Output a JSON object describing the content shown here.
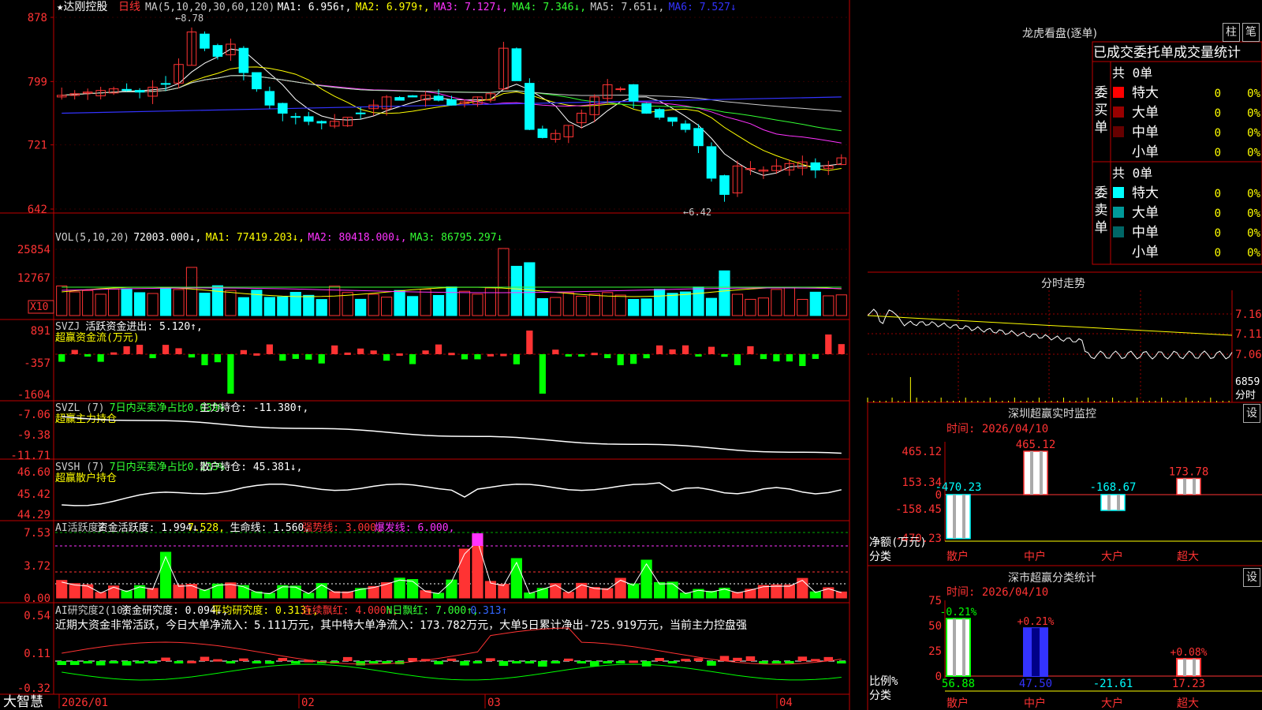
{
  "stock": {
    "title": "★达刚控股",
    "period": "日线"
  },
  "k": {
    "legend": [
      {
        "text": "MA(5,10,20,30,60,120)",
        "color": "#cccccc"
      },
      {
        "text": "MA1: 6.956↑,",
        "color": "#ffffff"
      },
      {
        "text": "MA2: 6.979↑,",
        "color": "#ffff00"
      },
      {
        "text": "MA3: 7.127↓,",
        "color": "#ff33ff"
      },
      {
        "text": "MA4: 7.346↓,",
        "color": "#33ff33"
      },
      {
        "text": "MA5: 7.651↓,",
        "color": "#cccccc"
      },
      {
        "text": "MA6: 7.527↓",
        "color": "#3333ff"
      }
    ],
    "yticks": [
      "878",
      "799",
      "721",
      "642"
    ],
    "max_label": "8.78",
    "min_label": "6.42",
    "ylim": [
      6.42,
      8.78
    ]
  },
  "vol": {
    "legend": [
      {
        "text": "VOL(5,10,20)",
        "color": "#cccccc"
      },
      {
        "text": "72003.000↓,",
        "color": "#ffffff"
      },
      {
        "text": "MA1: 77419.203↓,",
        "color": "#ffff00"
      },
      {
        "text": "MA2: 80418.000↓,",
        "color": "#ff33ff"
      },
      {
        "text": "MA3: 86795.297↓",
        "color": "#33ff33"
      }
    ],
    "yticks": [
      "25854",
      "12767"
    ],
    "unit": "X10"
  },
  "svzj": {
    "legend": [
      {
        "text": "SVZJ",
        "color": "#cccccc"
      },
      {
        "text": "活跃资金进出: 5.120↑,",
        "color": "#ffffff"
      }
    ],
    "subtitle": "超赢资金流(万元)",
    "yticks": [
      "891",
      "-357",
      "-1604"
    ]
  },
  "svzl": {
    "legend": [
      {
        "text": "SVZL (7)",
        "color": "#cccccc"
      },
      {
        "text": "7日内买卖净占比0.039%",
        "color": "#33ff33"
      },
      {
        "text": "主力持仓: -11.380↑,",
        "color": "#ffffff"
      }
    ],
    "subtitle": "超赢主力持仓",
    "yticks": [
      "-7.06",
      "-9.38",
      "-11.71"
    ]
  },
  "svsh": {
    "legend": [
      {
        "text": "SVSH (7)",
        "color": "#cccccc"
      },
      {
        "text": "7日内买卖净占比0.233%",
        "color": "#33ff33"
      },
      {
        "text": "散户持仓: 45.381↓,",
        "color": "#ffffff"
      }
    ],
    "subtitle": "超赢散户持仓",
    "yticks": [
      "46.60",
      "45.42",
      "44.29"
    ]
  },
  "ai": {
    "legend": [
      {
        "text": "AI活跃度2",
        "color": "#cccccc"
      },
      {
        "text": "资金活跃度: 1.994↓,",
        "color": "#ffffff"
      },
      {
        "text": "7.528,",
        "color": "#ffff00"
      },
      {
        "text": "生命线: 1.560,",
        "color": "#ffffff"
      },
      {
        "text": "强势线: 3.000,",
        "color": "#ff3333"
      },
      {
        "text": "爆发线: 6.000,",
        "color": "#ff33ff"
      }
    ],
    "yticks": [
      "7.53",
      "3.72",
      "0.00"
    ]
  },
  "research": {
    "legend": [
      {
        "text": "AI研究度2(10)",
        "color": "#cccccc"
      },
      {
        "text": "资金研究度: 0.094↓,",
        "color": "#ffffff"
      },
      {
        "text": "平均研究度: 0.313↑,",
        "color": "#ffff00"
      },
      {
        "text": "连续飘红: 4.000↑,",
        "color": "#ff3333"
      },
      {
        "text": "N日飘红: 7.000↑,",
        "color": "#33ff33"
      },
      {
        "text": "0.313↑",
        "color": "#3366ff"
      }
    ],
    "comment": "近期大资金非常活跃，今日大单净流入：5.111万元，其中特大单净流入：173.782万元，大单5日累计净出-725.919万元，当前主力控盘强",
    "yticks": [
      "0.54",
      "0.11",
      "-0.32"
    ]
  },
  "xaxis": {
    "labels": [
      "2026/01",
      "02",
      "03",
      "04"
    ],
    "brand": "大智慧"
  },
  "dragon": {
    "title": "龙虎看盘(逐单)",
    "btn_zhu": "柱",
    "btn_bi": "笔",
    "header": "已成交委托单成交量统计",
    "buy": {
      "side": "委买单",
      "total": "共 0单",
      "rows": [
        {
          "label": "特大",
          "val": "0",
          "pct": "0%",
          "color": "#ff0000"
        },
        {
          "label": "大单",
          "val": "0",
          "pct": "0%",
          "color": "#990000"
        },
        {
          "label": "中单",
          "val": "0",
          "pct": "0%",
          "color": "#660000"
        },
        {
          "label": "小单",
          "val": "0",
          "pct": "0%",
          "color": "#000000"
        }
      ]
    },
    "sell": {
      "side": "委卖单",
      "total": "共 0单",
      "rows": [
        {
          "label": "特大",
          "val": "0",
          "pct": "0%",
          "color": "#00ffff"
        },
        {
          "label": "大单",
          "val": "0",
          "pct": "0%",
          "color": "#009999"
        },
        {
          "label": "中单",
          "val": "0",
          "pct": "0%",
          "color": "#006666"
        },
        {
          "label": "小单",
          "val": "0",
          "pct": "0%",
          "color": "#000000"
        }
      ]
    }
  },
  "intraday": {
    "title": "分时走势",
    "yticks": [
      "7.16",
      "7.11",
      "7.06"
    ],
    "vol_label": "6859",
    "vol_unit": "分时"
  },
  "monitor": {
    "title": "深圳超赢实时监控",
    "btn": "设",
    "time": "时间: 2026/04/10",
    "yticks": [
      "465.12",
      "153.34",
      "0",
      "-158.45",
      "-470.23"
    ],
    "ylabel": "净额(万元)",
    "xlabel": "分类",
    "categories": [
      "散户",
      "中户",
      "大户",
      "超大"
    ],
    "values": [
      -470.23,
      465.12,
      -168.67,
      173.78
    ],
    "value_labels": [
      "-470.23",
      "465.12",
      "-168.67",
      "173.78"
    ]
  },
  "classify": {
    "title": "深市超赢分类统计",
    "btn": "设",
    "time": "时间: 2026/04/10",
    "yticks": [
      "75",
      "50",
      "25",
      "0"
    ],
    "ylabel": "比例%",
    "xlabel": "分类",
    "categories": [
      "散户",
      "中户",
      "大户",
      "超大"
    ],
    "values": [
      56.88,
      47.5,
      -21.61,
      17.23
    ],
    "value_labels": [
      "56.88",
      "47.50",
      "-21.61",
      "17.23"
    ],
    "change_labels": [
      "-0.21%",
      "+0.21%",
      "",
      "+0.08%"
    ]
  },
  "colors": {
    "up": "#ff3333",
    "down": "#00ffff",
    "grid": "#c00000",
    "green": "#00ff00"
  }
}
